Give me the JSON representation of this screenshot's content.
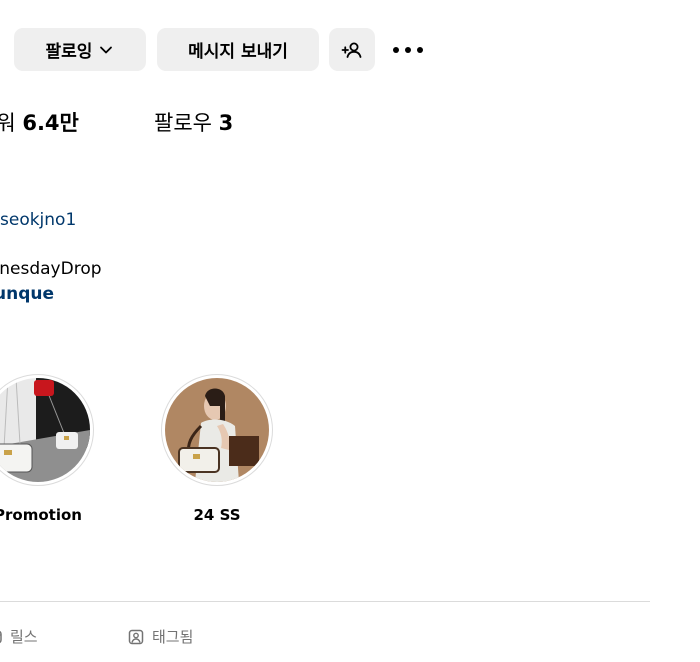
{
  "actions": {
    "follow_label": "팔로잉",
    "message_label": "메시지 보내기"
  },
  "stats": {
    "followers_label": "로워",
    "followers_value": "6.4만",
    "following_label": "팔로우",
    "following_value": "3"
  },
  "profile": {
    "handle": "seokjno1",
    "bio_line_1": "ednesdayDrop",
    "bio_link": "unque"
  },
  "highlights": [
    {
      "label": "Promotion"
    },
    {
      "label": "24 SS"
    }
  ],
  "tabs": [
    {
      "label": "릴스",
      "icon": "reels-icon"
    },
    {
      "label": "태그됨",
      "icon": "tagged-icon"
    }
  ],
  "colors": {
    "button_bg": "#efefef",
    "link": "#00376b",
    "muted": "#737373",
    "divider": "#dbdbdb"
  }
}
